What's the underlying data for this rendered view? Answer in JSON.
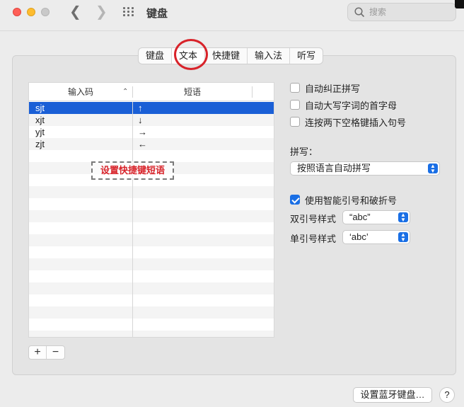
{
  "window": {
    "title": "键盘"
  },
  "search": {
    "placeholder": "搜索"
  },
  "tabs": [
    {
      "label": "键盘"
    },
    {
      "label": "文本"
    },
    {
      "label": "快捷键"
    },
    {
      "label": "输入法"
    },
    {
      "label": "听写"
    }
  ],
  "table": {
    "headers": {
      "replace": "输入码",
      "with": "短语"
    },
    "rows": [
      {
        "replace": "sjt",
        "with": "↑"
      },
      {
        "replace": "xjt",
        "with": "↓"
      },
      {
        "replace": "yjt",
        "with": "→"
      },
      {
        "replace": "zjt",
        "with": "←"
      }
    ]
  },
  "annotation": {
    "text": "设置快捷键短语"
  },
  "buttons": {
    "add": "+",
    "remove": "−",
    "bluetooth": "设置蓝牙键盘…",
    "help": "?"
  },
  "options": {
    "autocorrect": {
      "label": "自动纠正拼写",
      "checked": false
    },
    "capitalize": {
      "label": "自动大写字词的首字母",
      "checked": false
    },
    "period": {
      "label": "连按两下空格键插入句号",
      "checked": false
    },
    "smart_quotes": {
      "label": "使用智能引号和破折号",
      "checked": true
    }
  },
  "spelling": {
    "label": "拼写：",
    "value": "按照语言自动拼写"
  },
  "double_quotes": {
    "label": "双引号样式",
    "value": "“abc”"
  },
  "single_quotes": {
    "label": "单引号样式",
    "value": "‘abc’"
  },
  "colors": {
    "accent": "#1a6fe5",
    "annotation_red": "#d8232a",
    "selection": "#1a5fd6"
  }
}
